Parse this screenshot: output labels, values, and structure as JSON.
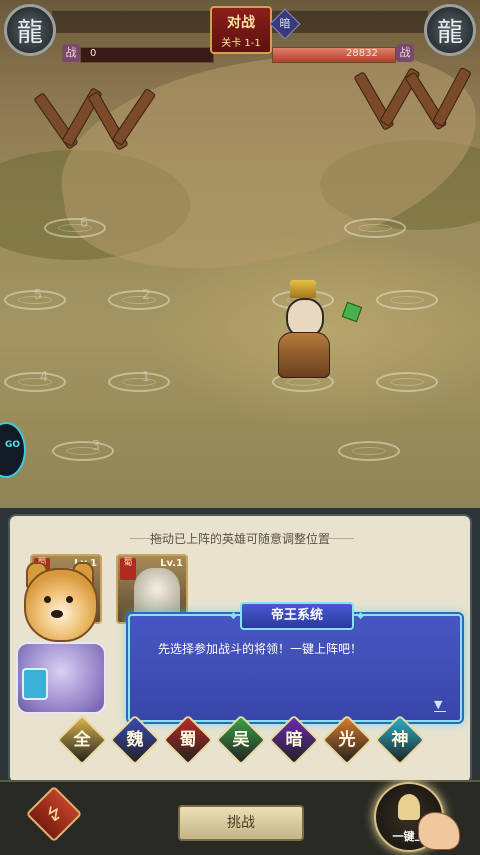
{
  "hud": {
    "title": "对战",
    "stage": "关卡 1-1",
    "dark_badge": "暗",
    "left_power_label": "战",
    "left_power_value": "0",
    "right_power_label": "战",
    "right_power_value": "28832",
    "left_power_fill": 0.0,
    "right_power_fill": 1.0
  },
  "slots": [
    "1",
    "2",
    "3",
    "4",
    "5",
    "6"
  ],
  "side_icon_text": "GO",
  "panel": {
    "tip": "拖动已上阵的英雄可随意调整位置",
    "cards": [
      {
        "faction": "蜀",
        "level": "Lv.1"
      },
      {
        "faction": "蜀",
        "level": "Lv.1"
      }
    ]
  },
  "dialog": {
    "title": "帝王系统",
    "text": "先选择参加战斗的将领！一键上阵吧！",
    "more": "▼"
  },
  "factions": [
    {
      "label": "全",
      "color": "#d8b24a"
    },
    {
      "label": "魏",
      "color": "#3a4ab8"
    },
    {
      "label": "蜀",
      "color": "#b82a24"
    },
    {
      "label": "吴",
      "color": "#3aa048"
    },
    {
      "label": "暗",
      "color": "#6a2ab0"
    },
    {
      "label": "光",
      "color": "#d87a2a"
    },
    {
      "label": "神",
      "color": "#2ab0c8"
    }
  ],
  "buttons": {
    "back_icon": "↯",
    "challenge": "挑战",
    "one_key": "一键上"
  },
  "emblem_icon": "dragon-icon"
}
